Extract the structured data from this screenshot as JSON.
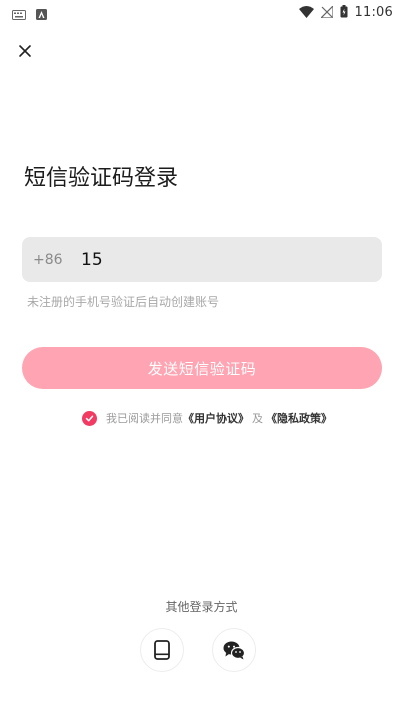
{
  "status_bar": {
    "time": "11:06",
    "icons": [
      "keyboard-icon",
      "app-notification-icon",
      "wifi-icon",
      "no-signal-icon",
      "battery-icon"
    ]
  },
  "header": {
    "close_icon": "close-icon"
  },
  "title": "短信验证码登录",
  "phone": {
    "country_code": "+86",
    "value": "15"
  },
  "hint": "未注册的手机号验证后自动创建账号",
  "send_button": {
    "label": "发送短信验证码",
    "color": "#ffa4b2"
  },
  "agreement": {
    "prefix": "我已阅读并同意",
    "user_agreement": "《用户协议》",
    "and": "及",
    "privacy_policy": "《隐私政策》",
    "checked": true,
    "check_color": "#f23a63"
  },
  "other_login": {
    "title": "其他登录方式",
    "methods": [
      "phone-icon",
      "wechat-icon"
    ]
  }
}
